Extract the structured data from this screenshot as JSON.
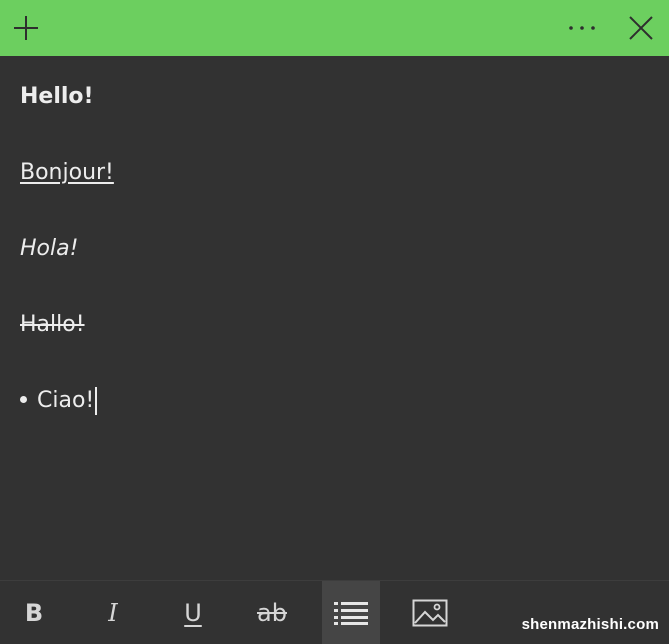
{
  "theme": {
    "accent": "#6ccf5f",
    "background": "#323232",
    "text": "#ededed"
  },
  "titlebar": {
    "add_icon": "plus-icon",
    "menu_icon": "more-icon",
    "close_icon": "close-icon"
  },
  "note": {
    "lines": [
      {
        "text": "Hello!",
        "format": "bold"
      },
      {
        "text": "Bonjour!",
        "format": "underline"
      },
      {
        "text": "Hola!",
        "format": "italic"
      },
      {
        "text": "Hallo!",
        "format": "strikethrough"
      },
      {
        "text": "Ciao!",
        "format": "bullet"
      }
    ]
  },
  "toolbar": {
    "bold_label": "B",
    "italic_label": "I",
    "underline_label": "U",
    "strike_label": "ab",
    "list_icon": "bullet-list-icon",
    "image_icon": "image-icon",
    "active": "bullet-list"
  },
  "watermark": "shenmazhishi.com"
}
